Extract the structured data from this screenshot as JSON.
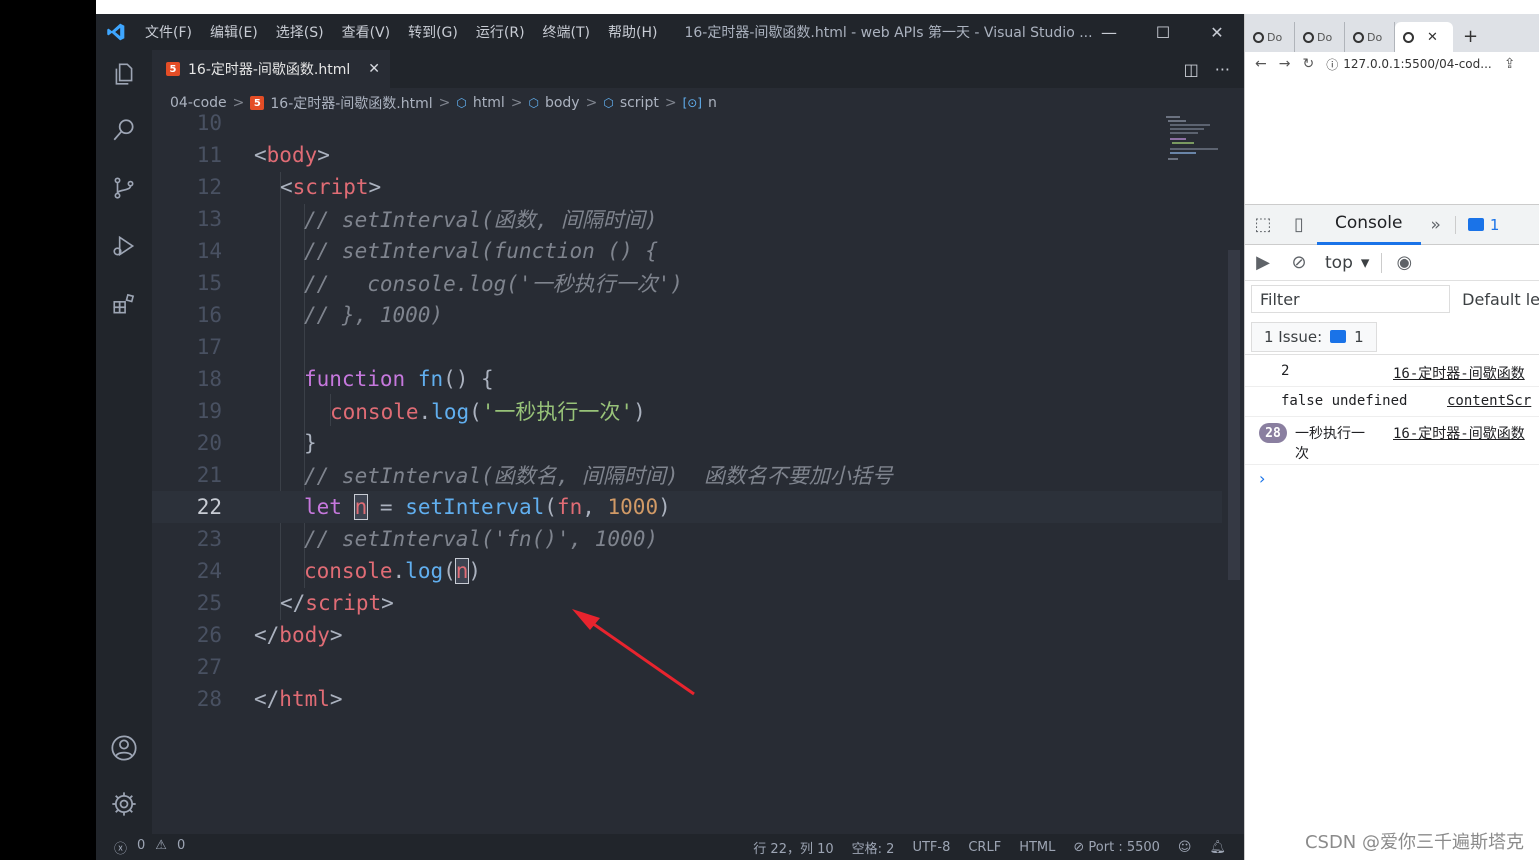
{
  "titlebar": {
    "menu": [
      "文件(F)",
      "编辑(E)",
      "选择(S)",
      "查看(V)",
      "转到(G)",
      "运行(R)",
      "终端(T)",
      "帮助(H)"
    ],
    "window_title": "16-定时器-间歇函数.html - web APIs 第一天 - Visual Studio ..."
  },
  "tab": {
    "label": "16-定时器-间歇函数.html"
  },
  "breadcrumb": {
    "folder": "04-code",
    "file": "16-定时器-间歇函数.html",
    "html": "html",
    "body": "body",
    "script": "script",
    "symbol": "n"
  },
  "code": {
    "numbers": [
      "10",
      "11",
      "12",
      "13",
      "14",
      "15",
      "16",
      "17",
      "18",
      "19",
      "20",
      "21",
      "22",
      "23",
      "24",
      "25",
      "26",
      "27",
      "28"
    ],
    "l11_tag": "body",
    "l12_tag": "script",
    "l13": "// setInterval(函数, 间隔时间)",
    "l14": "// setInterval(function () {",
    "l15": "//   console.log('一秒执行一次')",
    "l16": "// }, 1000)",
    "l18_kw": "function",
    "l18_fn": "fn",
    "l19_obj": "console",
    "l19_fn": "log",
    "l19_str": "'一秒执行一次'",
    "l21": "// setInterval(函数名, 间隔时间)  函数名不要加小括号",
    "l22_kw": "let",
    "l22_var": "n",
    "l22_fn": "setInterval",
    "l22_arg": "fn",
    "l22_num": "1000",
    "l23": "// setInterval('fn()', 1000)",
    "l24_obj": "console",
    "l24_fn": "log",
    "l24_var": "n",
    "l25_tag": "script",
    "l26_tag": "body",
    "l28_tag": "html"
  },
  "status": {
    "errors": "0",
    "warnings": "0",
    "position": "行 22，列 10",
    "spaces": "空格: 2",
    "encoding": "UTF-8",
    "eol": "CRLF",
    "language": "HTML",
    "port": "Port : 5500"
  },
  "browser": {
    "tabs": [
      "Do",
      "Do",
      "Do"
    ],
    "url": "127.0.0.1:5500/04-cod..."
  },
  "devtools": {
    "console_tab": "Console",
    "issue_count_badge": "1",
    "context": "top",
    "filter_placeholder": "Filter",
    "levels": "Default le",
    "issues_label": "1 Issue:",
    "issues_count": "1",
    "rows": [
      {
        "value": "2",
        "source": "16-定时器-间歇函数"
      },
      {
        "value": "false undefined",
        "source": "contentScr"
      },
      {
        "count": "28",
        "value": "一秒执行一",
        "value2": "次",
        "source": "16-定时器-间歇函数"
      }
    ]
  },
  "watermark": "CSDN @爱你三千遍斯塔克"
}
